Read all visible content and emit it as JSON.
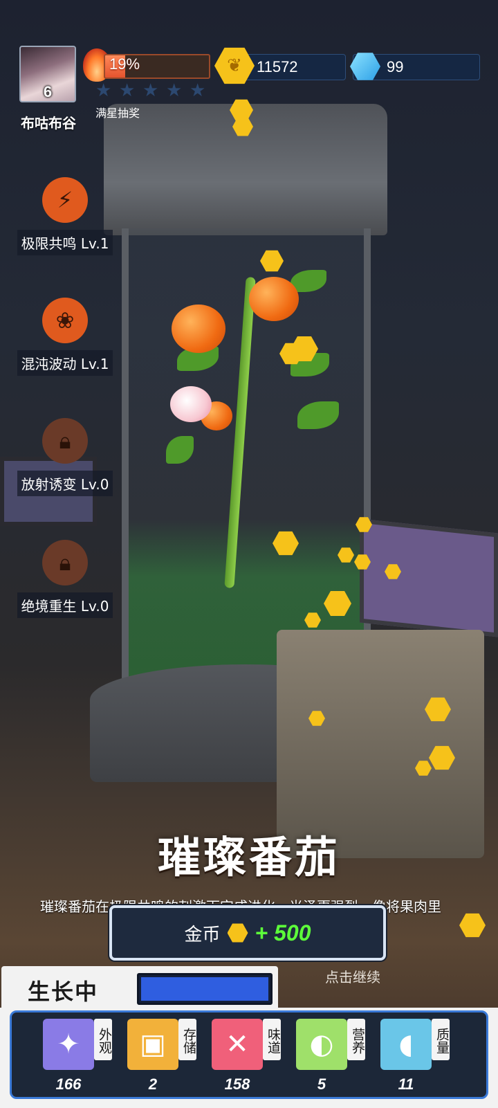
{
  "player": {
    "level": "6",
    "name": "布咕布谷"
  },
  "progress": {
    "percent_text": "19%",
    "fill_fraction": 0.19,
    "stars_filled": 0,
    "stars_total": 5,
    "stars_label": "满星抽奖"
  },
  "currency": {
    "coins": "11572",
    "gems": "99"
  },
  "skills": [
    {
      "label": "极限共鸣 Lv.1",
      "icon": "resonance-icon",
      "locked": false
    },
    {
      "label": "混沌波动 Lv.1",
      "icon": "chaos-wave-icon",
      "locked": false
    },
    {
      "label": "放射诱变 Lv.0",
      "icon": "lock-icon",
      "locked": true
    },
    {
      "label": "绝境重生 Lv.0",
      "icon": "lock-icon",
      "locked": true
    }
  ],
  "result": {
    "plant_name": "璀璨番茄",
    "description": "璀璨番茄在极限共鸣的刺激下完成进化，光泽更强烈，像将果肉里",
    "reward_label": "金币",
    "reward_amount": "+ 500",
    "continue_hint": "点击继续"
  },
  "growth": {
    "status_label": "生长中",
    "fill_fraction": 1.0
  },
  "stats": [
    {
      "tag": "外观",
      "value": "166",
      "icon": "sparkle-icon",
      "color": "#8a7be6"
    },
    {
      "tag": "存储",
      "value": "2",
      "icon": "box-icon",
      "color": "#f2b13a"
    },
    {
      "tag": "味道",
      "value": "158",
      "icon": "fork-knife-icon",
      "color": "#f0607a"
    },
    {
      "tag": "营养",
      "value": "5",
      "icon": "lime-icon",
      "color": "#9fe06a"
    },
    {
      "tag": "质量",
      "value": "11",
      "icon": "muscle-icon",
      "color": "#6ac6e8"
    }
  ],
  "colors": {
    "coin": "#f6c21a",
    "reward_green": "#5dff3a",
    "panel_blue": "#3a7ad8"
  }
}
